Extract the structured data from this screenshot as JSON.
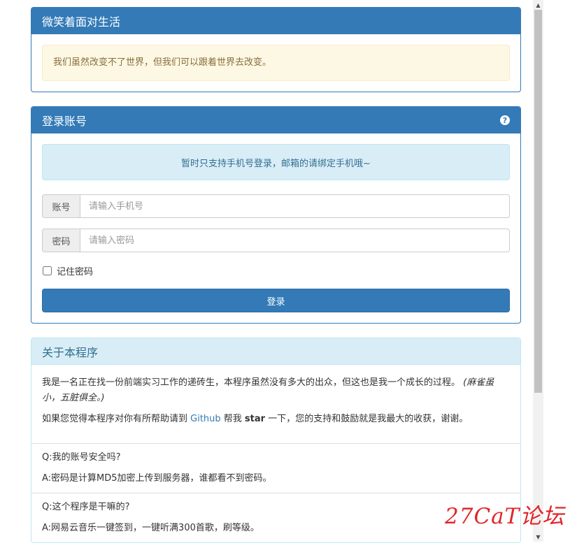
{
  "motto": {
    "title": "微笑着面对生活",
    "message": "我们虽然改变不了世界，但我们可以跟着世界去改变。"
  },
  "login": {
    "title": "登录账号",
    "help_icon": "question-circle-icon",
    "notice": "暂时只支持手机号登录，邮箱的请绑定手机哦~",
    "account_label": "账号",
    "account_placeholder": "请输入手机号",
    "account_value": "",
    "password_label": "密码",
    "password_placeholder": "请输入密码",
    "password_value": "",
    "remember_label": "记住密码",
    "remember_checked": false,
    "submit_label": "登录"
  },
  "about": {
    "title": "关于本程序",
    "intro": "我是一名正在找一份前端实习工作的递砖生，本程序虽然没有多大的出众，但这也是我一个成长的过程。",
    "intro_aside": "(麻雀虽小，五脏俱全。)",
    "support_prefix": "如果您觉得本程序对你有所帮助请到 ",
    "support_link": "Github",
    "support_mid": " 帮我 ",
    "support_bold": "star",
    "support_suffix": " 一下，您的支持和鼓励就是我最大的收获，谢谢。",
    "faq": [
      {
        "q": "Q:我的账号安全吗?",
        "a": "A:密码是计算MD5加密上传到服务器，谁都看不到密码。"
      },
      {
        "q": "Q:这个程序是干嘛的?",
        "a": "A:网易云音乐一键签到，一键听满300首歌，刷等级。"
      }
    ]
  },
  "watermark": "27CaT论坛",
  "colors": {
    "primary": "#337ab7",
    "info_bg": "#d9edf7",
    "warning_bg": "#fcf8e3",
    "watermark": "#e0262a"
  }
}
